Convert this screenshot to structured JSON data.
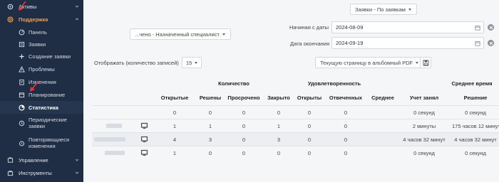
{
  "sidebar": {
    "items": [
      {
        "label": "Активы",
        "icon": "asset-icon"
      },
      {
        "label": "Поддержка",
        "icon": "support-icon"
      },
      {
        "label": "Панель",
        "icon": "dashboard-icon"
      },
      {
        "label": "Заявки",
        "icon": "list-icon"
      },
      {
        "label": "Создание заявки",
        "icon": "plus-icon"
      },
      {
        "label": "Проблемы",
        "icon": "warning-icon"
      },
      {
        "label": "Изменения",
        "icon": "clipboard-icon"
      },
      {
        "label": "Планирование",
        "icon": "calendar-icon"
      },
      {
        "label": "Статистика",
        "icon": "pie-chart-icon"
      },
      {
        "label": "Периодические заявки",
        "icon": "recurrent-icon"
      },
      {
        "label": "Повторяющиеся изменения",
        "icon": "alarm-icon"
      },
      {
        "label": "Управление",
        "icon": "management-icon"
      },
      {
        "label": "Инструменты",
        "icon": "tools-icon"
      }
    ]
  },
  "filters": {
    "type_select": "Заявки - По заявкам",
    "assign_select": "...чено - Назначенный специалист",
    "start_label": "Начиная с даты",
    "start_date": "2024-08-09",
    "end_label": "Дата окончания",
    "end_date": "2024-09-19"
  },
  "display": {
    "label": "Отображать (количество записей)",
    "count": "15",
    "export_select": "Текущую страницу в альбомный PDF"
  },
  "table": {
    "groups": {
      "quantity": "Количество",
      "satisfaction": "Удовлетворенность",
      "avg_time": "Среднее время"
    },
    "columns": [
      "Открытые",
      "Решены",
      "Просрочено",
      "Закрыто",
      "Открыты",
      "Отвеченных",
      "Среднее",
      "Учет занял",
      "Решение"
    ],
    "rows": [
      {
        "cells": [
          "0",
          "0",
          "0",
          "0",
          "0",
          "0",
          "",
          "0 секунд",
          "0 секунд"
        ],
        "has_name": false
      },
      {
        "cells": [
          "1",
          "1",
          "0",
          "1",
          "0",
          "0",
          "",
          "2 минуты",
          "175 часов 12 минут"
        ],
        "has_name": true
      },
      {
        "cells": [
          "4",
          "3",
          "0",
          "3",
          "0",
          "0",
          "",
          "4 часов 32 минут",
          "4 часов 32 минут"
        ],
        "has_name": true
      },
      {
        "cells": [
          "1",
          "0",
          "0",
          "0",
          "0",
          "0",
          "",
          "0 секунд",
          "0 секунд"
        ],
        "has_name": true
      }
    ]
  },
  "colors": {
    "sidebar_bg": "#1f2d45",
    "accent": "#f0a04b",
    "arrow": "#e53935"
  }
}
